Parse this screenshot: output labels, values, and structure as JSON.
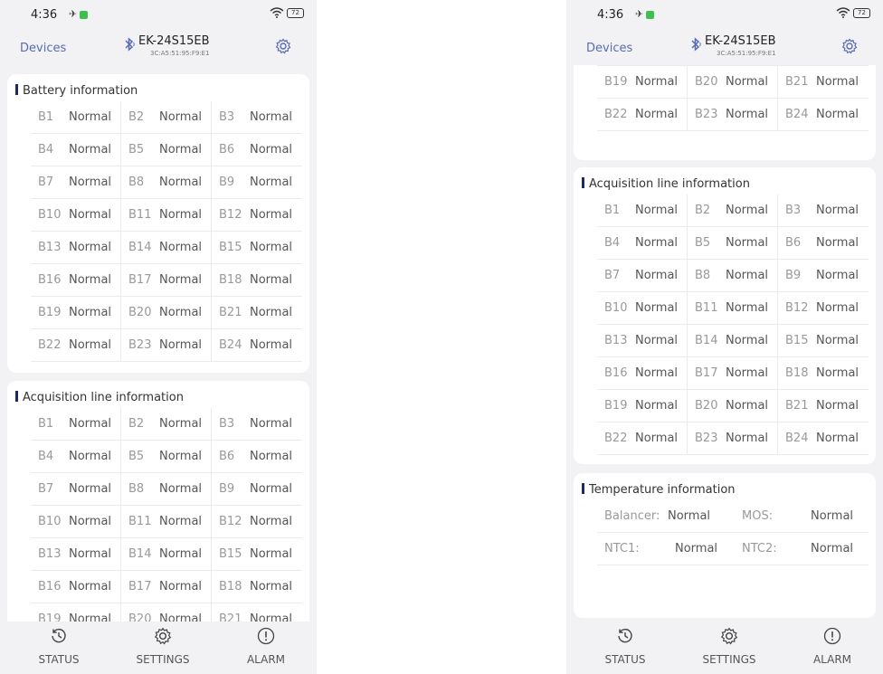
{
  "status_bar": {
    "time": "4:36",
    "battery": "72"
  },
  "header": {
    "back_label": "Devices",
    "device_name": "EK-24S15EB",
    "device_mac": "3C:A5:51:95:F9:E1"
  },
  "sections": {
    "battery_title": "Battery information",
    "acquisition_title": "Acquisition line information",
    "temperature_title": "Temperature information"
  },
  "cells": [
    {
      "id": "B1",
      "status": "Normal"
    },
    {
      "id": "B2",
      "status": "Normal"
    },
    {
      "id": "B3",
      "status": "Normal"
    },
    {
      "id": "B4",
      "status": "Normal"
    },
    {
      "id": "B5",
      "status": "Normal"
    },
    {
      "id": "B6",
      "status": "Normal"
    },
    {
      "id": "B7",
      "status": "Normal"
    },
    {
      "id": "B8",
      "status": "Normal"
    },
    {
      "id": "B9",
      "status": "Normal"
    },
    {
      "id": "B10",
      "status": "Normal"
    },
    {
      "id": "B11",
      "status": "Normal"
    },
    {
      "id": "B12",
      "status": "Normal"
    },
    {
      "id": "B13",
      "status": "Normal"
    },
    {
      "id": "B14",
      "status": "Normal"
    },
    {
      "id": "B15",
      "status": "Normal"
    },
    {
      "id": "B16",
      "status": "Normal"
    },
    {
      "id": "B17",
      "status": "Normal"
    },
    {
      "id": "B18",
      "status": "Normal"
    },
    {
      "id": "B19",
      "status": "Normal"
    },
    {
      "id": "B20",
      "status": "Normal"
    },
    {
      "id": "B21",
      "status": "Normal"
    },
    {
      "id": "B22",
      "status": "Normal"
    },
    {
      "id": "B23",
      "status": "Normal"
    },
    {
      "id": "B24",
      "status": "Normal"
    }
  ],
  "temperature": {
    "balancer_label": "Balancer:",
    "balancer_value": "Normal",
    "mos_label": "MOS:",
    "mos_value": "Normal",
    "ntc1_label": "NTC1:",
    "ntc1_value": "Normal",
    "ntc2_label": "NTC2:",
    "ntc2_value": "Normal"
  },
  "tabs": {
    "status": "STATUS",
    "settings": "SETTINGS",
    "alarm": "ALARM"
  },
  "icons": {
    "bluetooth": "bluetooth-icon",
    "gear": "gear-icon",
    "history": "history-icon",
    "alarm": "alarm-icon",
    "wifi": "wifi-icon"
  },
  "colors": {
    "accent": "#5a6bb5",
    "section_marker": "#1c2a6b",
    "background": "#f2f2f4",
    "card": "#ffffff"
  }
}
